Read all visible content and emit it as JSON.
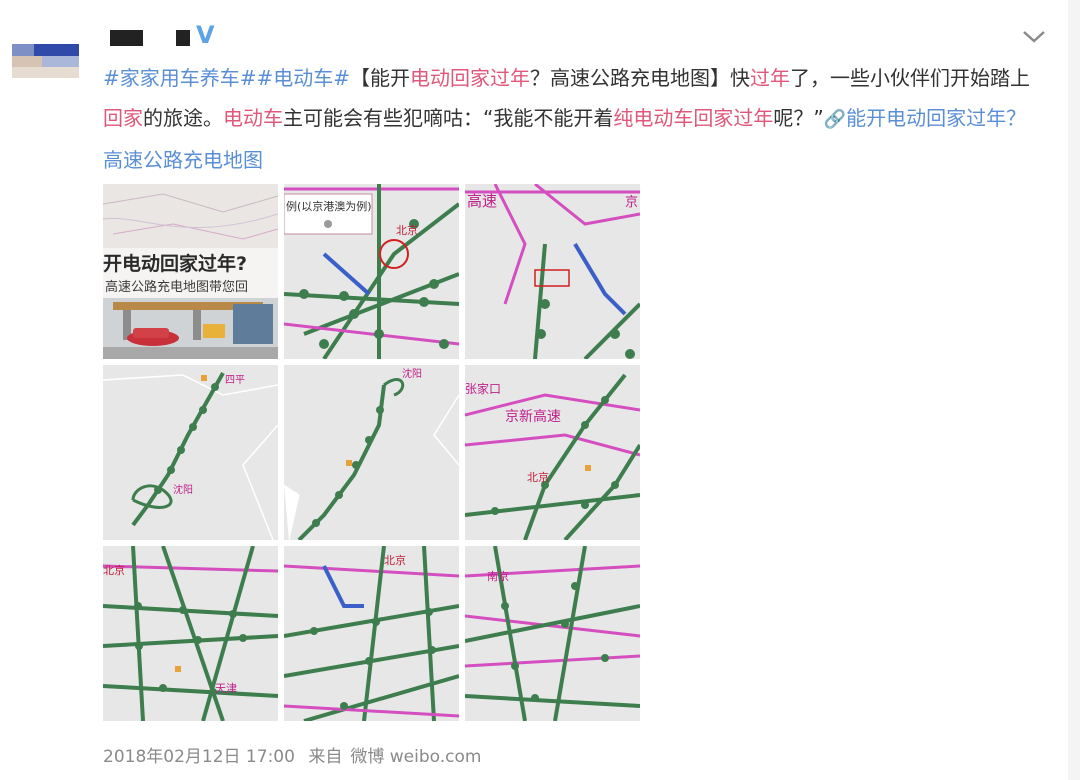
{
  "post": {
    "verified_badge": "V",
    "content": {
      "topic1": "#家家用车养车#",
      "topic2": "#电动车#",
      "t1": "【能开",
      "k1": "电动回家过年",
      "t2": "？高速公路充电地图】快",
      "k2": "过年",
      "t3": "了，一些小伙伴们开始踏上",
      "k3": "回家",
      "t4": "的旅途。",
      "k4": "电动车",
      "t5": "主可能会有些犯嘀咕：“我能不能开着",
      "k5": "纯电动车回家过年",
      "t6": "呢？”",
      "link_icon": "🔗",
      "link_text": "能开电动回家过年？高速公路充电地图"
    },
    "images": {
      "img1": {
        "headline": "开电动回家过年?",
        "subline": "高速公路充电地图带您回"
      },
      "img2": {
        "legend": "例(以京港澳为例)",
        "city": "北京"
      },
      "img3": {
        "label": "高速",
        "tag": "京"
      },
      "img4": {
        "city_top": "四平",
        "city": "沈阳"
      },
      "img5": {
        "city": "沈阳"
      },
      "img6": {
        "city_top": "张家口",
        "road": "京新高速",
        "city": "北京"
      },
      "img7": {
        "city_top": "北京",
        "city": "天津"
      },
      "img8": {
        "city": "北京"
      },
      "img9": {
        "city": "南京"
      }
    },
    "footer": {
      "datetime": "2018年02月12日 17:00",
      "from_label": "来自",
      "source": "微博 weibo.com"
    },
    "colors": {
      "topic": "#5a8fd6",
      "keyword": "#e0577a",
      "road_green": "#3e7d4e",
      "road_pink": "#d44ec0",
      "road_blue": "#3a5fc8",
      "map_bg": "#e7e7e7"
    }
  }
}
